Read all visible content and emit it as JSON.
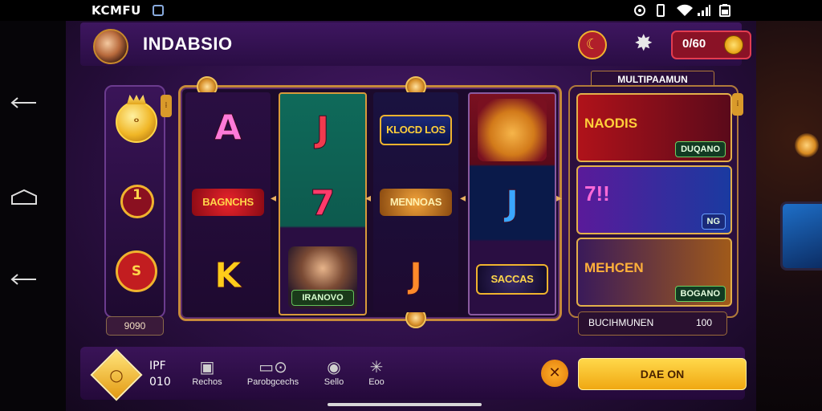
{
  "status_bar": {
    "carrier": "KCMFU",
    "icons": [
      "data-saver-icon",
      "record-icon",
      "vibrate-icon",
      "wifi-icon",
      "signal-icon",
      "battery-icon"
    ]
  },
  "system_nav": {
    "icons": [
      "back-icon",
      "home-icon",
      "recent-apps-icon"
    ]
  },
  "header": {
    "title": "INDABSIO",
    "coin_balance": "0/60",
    "icons": [
      "avatar",
      "moon-icon",
      "star-badge-icon",
      "coin-icon"
    ]
  },
  "left_column": {
    "crown_coin_text": "ᴼ",
    "round_1_label": "1",
    "round_2_label": "S",
    "badge": "9090"
  },
  "reels": [
    {
      "cells": [
        {
          "type": "letter",
          "text": "A",
          "color": "#ff7ad8"
        },
        {
          "type": "label",
          "text": "BAGNCHS"
        },
        {
          "type": "letter",
          "text": "K",
          "color": "#ffcc1a"
        }
      ]
    },
    {
      "cells": [
        {
          "type": "letter",
          "text": "J",
          "color": "#f23a4e"
        },
        {
          "type": "letter",
          "text": "7",
          "color": "#ff3a6a"
        },
        {
          "type": "char",
          "name": "IRANOVO"
        }
      ]
    },
    {
      "cells": [
        {
          "type": "label",
          "text": "KLOCD LOS"
        },
        {
          "type": "label",
          "text": "MENNOAS"
        },
        {
          "type": "letter",
          "text": "J",
          "color": "#ff8a2a"
        }
      ]
    },
    {
      "cells": [
        {
          "type": "char",
          "name": ""
        },
        {
          "type": "letter",
          "text": "J",
          "color": "#3aa6ff"
        },
        {
          "type": "label",
          "text": "SACCAS"
        }
      ]
    }
  ],
  "right_panel": {
    "header": "MULTIPAAMUN",
    "tiles": [
      {
        "text": "NAODIS",
        "chip": "DUQANO"
      },
      {
        "text": "7!!",
        "chip": "NG"
      },
      {
        "text": "MEHCEN",
        "chip": "BOGANO"
      }
    ],
    "footer_label": "BUCIHMUNEN",
    "footer_value": "100"
  },
  "bottom_bar": {
    "ipf_top": "IPF",
    "ipf_bottom": "010",
    "nav": [
      {
        "label": "Rechos",
        "icon": "camera-icon"
      },
      {
        "label": "Parobgcechs",
        "icon": "controller-icon"
      },
      {
        "label": "Sello",
        "icon": "chat-icon"
      },
      {
        "label": "Eoo",
        "icon": "sparkle-icon"
      }
    ],
    "spin_label": "DAE ON"
  },
  "colors": {
    "accent_gold": "#f0b32e",
    "purple_bg": "#2c0f44",
    "coin_red": "#8a1226"
  }
}
